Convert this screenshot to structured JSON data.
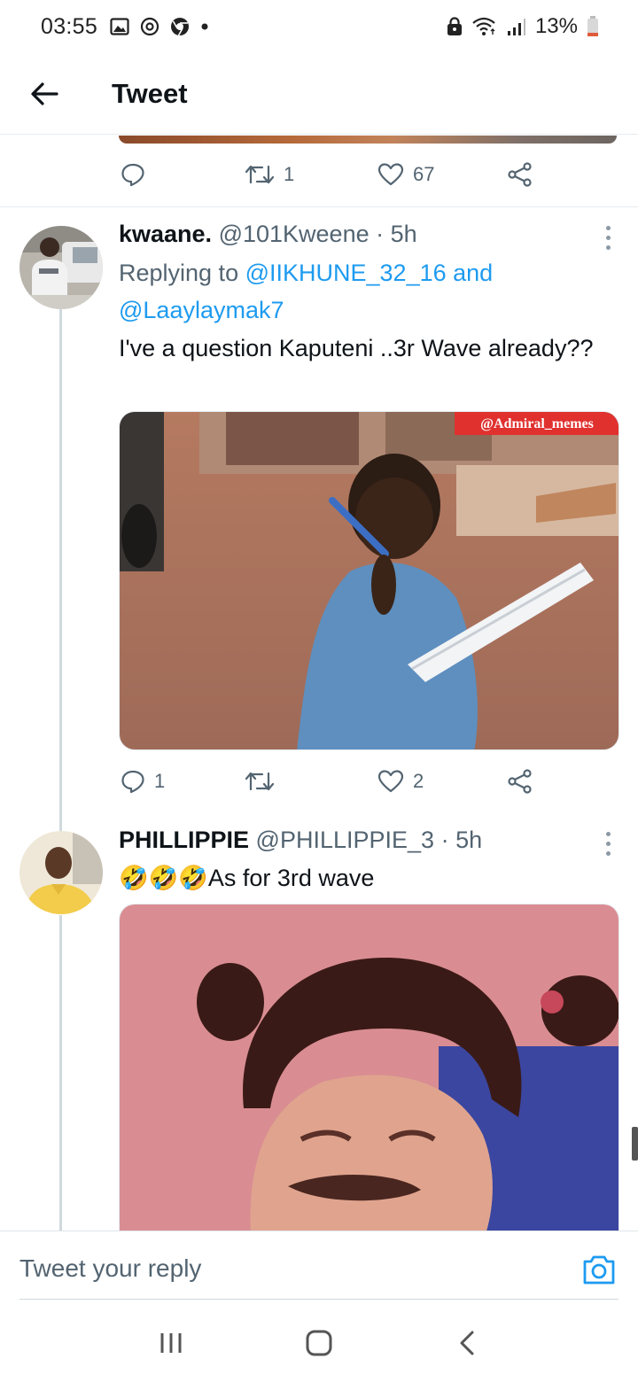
{
  "status_bar": {
    "time": "03:55",
    "battery": "13%",
    "icons": [
      "gallery-icon",
      "at-icon",
      "chrome-icon",
      "dot-icon",
      "lock-icon",
      "wifi-icon",
      "signal-icon",
      "battery-icon"
    ]
  },
  "header": {
    "title": "Tweet",
    "back_icon": "arrow-left-icon"
  },
  "previous_tweet": {
    "replies": "",
    "retweets": "1",
    "likes": "67"
  },
  "tweets": [
    {
      "name": "kwaane.",
      "handle": "@101Kweene",
      "separator": "·",
      "time": "5h",
      "reply_prefix": "Replying to ",
      "reply_mention_1": "@IIKHUNE_32_16",
      "reply_and": " and ",
      "reply_mention_2": "@Laaylaymak7",
      "text": "I've a question Kaputeni ..3r Wave already??",
      "media_watermark": "@Admiral_memes",
      "replies": "1",
      "retweets": "",
      "likes": "2"
    },
    {
      "name": "PHILLIPPIE",
      "handle": "@PHILLIPPIE_3",
      "separator": "·",
      "time": "5h",
      "text": "🤣🤣🤣As for 3rd wave"
    }
  ],
  "composer": {
    "placeholder": "Tweet your reply"
  },
  "colors": {
    "accent": "#1d9bf0",
    "secondary_text": "#536471",
    "divider": "#e6ecf0"
  }
}
